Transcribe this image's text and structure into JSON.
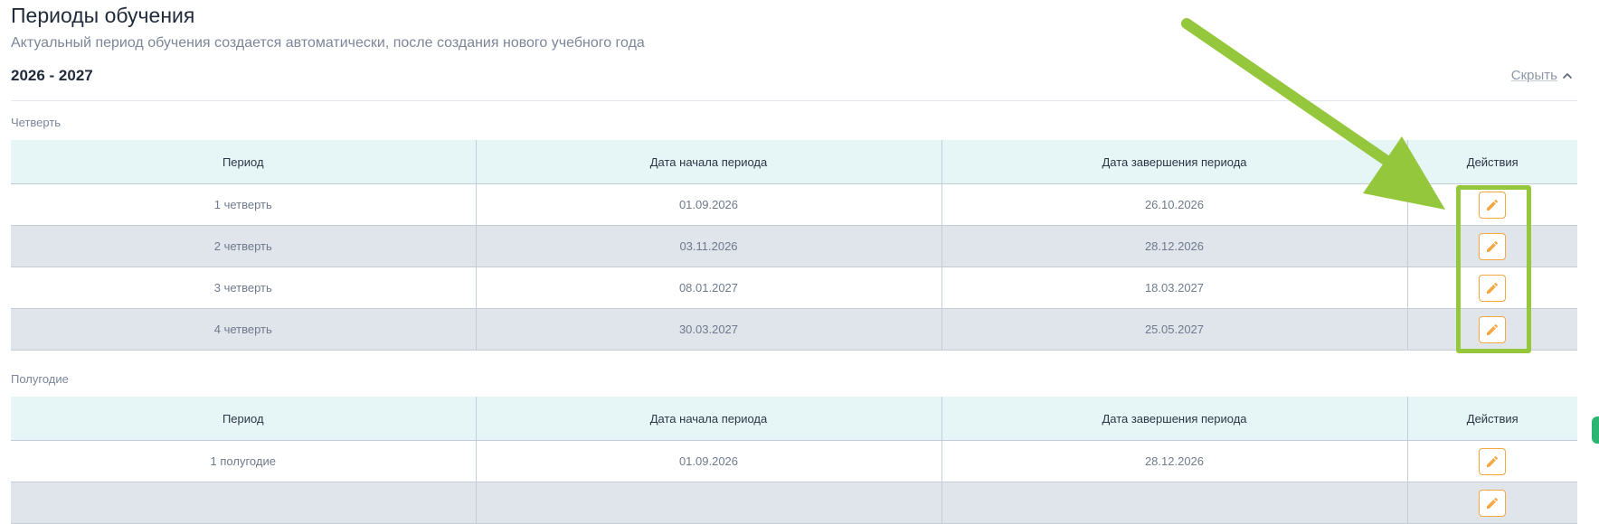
{
  "header": {
    "title": "Периоды обучения",
    "subtitle": "Актуальный период обучения создается автоматически, после создания нового учебного года"
  },
  "year": {
    "label": "2026 - 2027",
    "hide_label": "Скрыть"
  },
  "columns": [
    "Период",
    "Дата начала периода",
    "Дата завершения периода",
    "Действия"
  ],
  "quarters": {
    "label": "Четверть",
    "rows": [
      {
        "period": "1 четверть",
        "start": "01.09.2026",
        "end": "26.10.2026"
      },
      {
        "period": "2 четверть",
        "start": "03.11.2026",
        "end": "28.12.2026"
      },
      {
        "period": "3 четверть",
        "start": "08.01.2027",
        "end": "18.03.2027"
      },
      {
        "period": "4 четверть",
        "start": "30.03.2027",
        "end": "25.05.2027"
      }
    ]
  },
  "halves": {
    "label": "Полугодие",
    "rows": [
      {
        "period": "1 полугодие",
        "start": "01.09.2026",
        "end": "28.12.2026"
      }
    ]
  },
  "icons": {
    "edit": "pencil-icon",
    "hide": "chevron-up-icon"
  },
  "colors": {
    "header_bg": "#e6f5f6",
    "alt_row_bg": "#e0e4eb",
    "edit_accent": "#f5a742",
    "annotation": "#95c73c"
  }
}
